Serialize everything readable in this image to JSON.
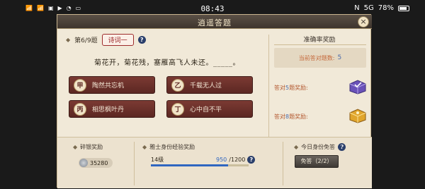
{
  "statusbar": {
    "left_icons": [
      "4G",
      "4G",
      "gallery",
      "play",
      "wifi",
      "cast"
    ],
    "time": "08:43",
    "right_text": "78%",
    "network": "5G"
  },
  "dialog": {
    "title": "逍遥答题",
    "close_label": "×",
    "question_number": "第6/9题",
    "question_type": "诗词一",
    "question_text": "菊花开，菊花残，塞雁高飞人未还。_____。",
    "options": [
      {
        "badge": "甲",
        "text": "陶然共忘机"
      },
      {
        "badge": "乙",
        "text": "千载无人过"
      },
      {
        "badge": "丙",
        "text": "相思枫叶丹"
      },
      {
        "badge": "丁",
        "text": "心中自不平"
      }
    ]
  },
  "accuracy": {
    "title": "准确率奖励",
    "current_label": "当前答对题数:",
    "current_value": "5",
    "reward1_prefix": "答对",
    "reward1_count": "5",
    "reward1_suffix": "题奖励:",
    "reward2_prefix": "答对",
    "reward2_count": "8",
    "reward2_suffix": "题奖励:"
  },
  "bottom": {
    "silver_title": "碎银奖励",
    "silver_amount": "35280",
    "exp_title": "雅士身份经验奖励",
    "level": "14级",
    "xp_current": "950",
    "xp_total": "/1200",
    "xp_progress": 0.79,
    "free_title": "今日身份免答",
    "free_button": "免答（2/2）"
  },
  "colors": {
    "accent_blue": "#2f66c0",
    "option_red": "#7b3a33",
    "panel_bg": "#f1e9d8"
  }
}
